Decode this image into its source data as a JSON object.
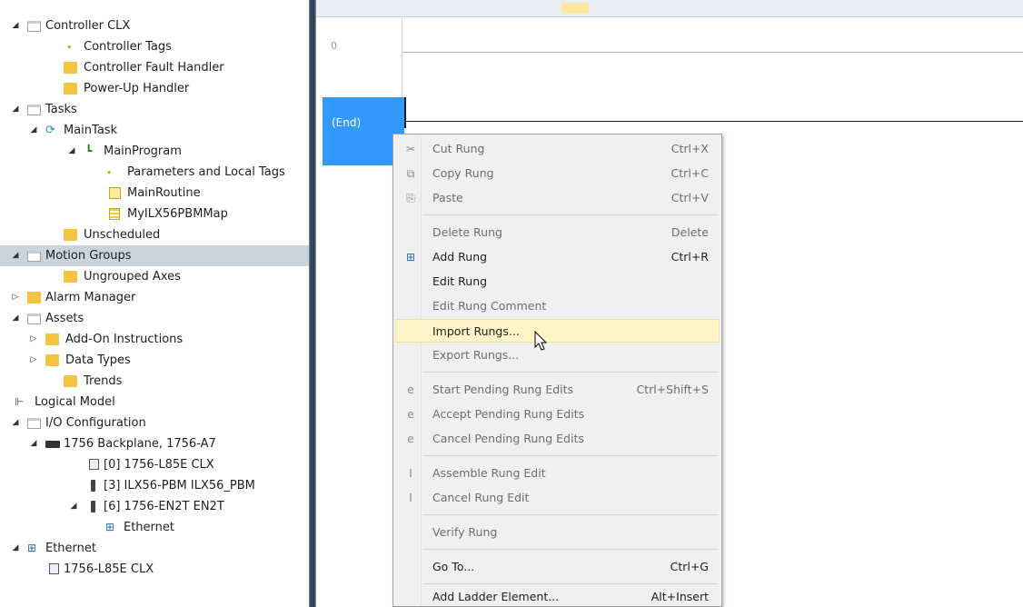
{
  "tree": {
    "items": [
      {
        "label": "Controller CLX",
        "toggle": "◢"
      },
      {
        "label": "Controller Tags"
      },
      {
        "label": "Controller Fault Handler"
      },
      {
        "label": "Power-Up Handler"
      },
      {
        "label": "Tasks",
        "toggle": "◢"
      },
      {
        "label": "MainTask",
        "toggle": "◢"
      },
      {
        "label": "MainProgram",
        "toggle": "◢"
      },
      {
        "label": "Parameters and Local Tags"
      },
      {
        "label": "MainRoutine"
      },
      {
        "label": "MyILX56PBMMap"
      },
      {
        "label": "Unscheduled"
      },
      {
        "label": "Motion Groups",
        "toggle": "◢"
      },
      {
        "label": "Ungrouped Axes"
      },
      {
        "label": "Alarm Manager",
        "toggle": "▷"
      },
      {
        "label": "Assets",
        "toggle": "◢"
      },
      {
        "label": "Add-On Instructions",
        "toggle": "▷"
      },
      {
        "label": "Data Types",
        "toggle": "▷"
      },
      {
        "label": "Trends"
      },
      {
        "label": "Logical Model"
      },
      {
        "label": "I/O Configuration",
        "toggle": "◢"
      },
      {
        "label": "1756 Backplane, 1756-A7",
        "toggle": "◢"
      },
      {
        "label": "[0] 1756-L85E CLX"
      },
      {
        "label": "[3] ILX56-PBM ILX56_PBM"
      },
      {
        "label": "[6] 1756-EN2T EN2T",
        "toggle": "◢"
      },
      {
        "label": "Ethernet"
      },
      {
        "label": "Ethernet",
        "toggle": "◢"
      },
      {
        "label": "1756-L85E CLX"
      }
    ]
  },
  "ladder": {
    "rung0_number": "0",
    "end_label": "(End)"
  },
  "context_menu": {
    "items": [
      {
        "label": "Cut Rung",
        "shortcut": "Ctrl+X",
        "icon": "✂"
      },
      {
        "label": "Copy Rung",
        "shortcut": "Ctrl+C",
        "icon": "⧉"
      },
      {
        "label": "Paste",
        "shortcut": "Ctrl+V",
        "icon": "⎘"
      },
      {
        "label": "Delete Rung",
        "shortcut": "Delete"
      },
      {
        "label": "Add Rung",
        "shortcut": "Ctrl+R",
        "icon": "⊞"
      },
      {
        "label": "Edit Rung",
        "shortcut": ""
      },
      {
        "label": "Edit Rung Comment",
        "shortcut": ""
      },
      {
        "label": "Import Rungs...",
        "shortcut": ""
      },
      {
        "label": "Export Rungs...",
        "shortcut": ""
      },
      {
        "label": "Start Pending Rung Edits",
        "shortcut": "Ctrl+Shift+S",
        "icon": "e"
      },
      {
        "label": "Accept Pending Rung Edits",
        "shortcut": "",
        "icon": "e"
      },
      {
        "label": "Cancel Pending Rung Edits",
        "shortcut": "",
        "icon": "e"
      },
      {
        "label": "Assemble Rung Edit",
        "shortcut": "",
        "icon": "I"
      },
      {
        "label": "Cancel Rung Edit",
        "shortcut": "",
        "icon": "I"
      },
      {
        "label": "Verify Rung",
        "shortcut": ""
      },
      {
        "label": "Go To...",
        "shortcut": "Ctrl+G"
      },
      {
        "label": "Add Ladder Element...",
        "shortcut": "Alt+Insert"
      }
    ]
  },
  "colors": {
    "selection": "#3399ff",
    "tree_selected": "#cad4df",
    "menu_hover": "#fdf5c8"
  }
}
